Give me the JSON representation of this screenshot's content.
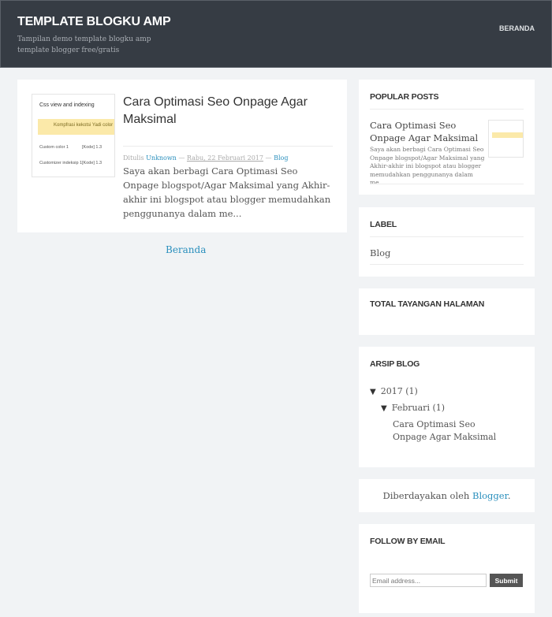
{
  "header": {
    "title": "TEMPLATE BLOGKU AMP",
    "description": "Tampilan demo template blogku amp template blogger free/gratis",
    "nav_home": "BERANDA",
    "background": "#363c44"
  },
  "post": {
    "title": "Cara Optimasi Seo Onpage Agar Maksimal",
    "meta_prefix": "Ditulis",
    "author": "Unknown",
    "sep1": "—",
    "date": "Rabu, 22 Februari 2017",
    "sep2": "—",
    "label": "Blog",
    "excerpt": "Saya akan berbagi Cara Optimasi Seo Onpage blogspot/Agar Maksimal yang Akhir-akhir ini blogspot atau blogger memudahkan penggunanya dalam me...",
    "thumbnail": {
      "heading": "Css view and indexing",
      "band_text": "Kompfrasi kekotsi  Yadi color",
      "row1_label": "Custom color  1",
      "row1_value": "[Kode]  1.3",
      "row2_label": "Customizer  indeksip  1",
      "row2_value": "[Kode]  1.3"
    }
  },
  "pager": {
    "home": "Beranda"
  },
  "sidebar": {
    "popular": {
      "title": "POPULAR POSTS",
      "post_title": "Cara Optimasi Seo Onpage Agar Maksimal",
      "snippet": "Saya akan berbagi Cara Optimasi Seo Onpage blogspot/Agar Maksimal yang Akhir-akhir ini blogspot atau blogger memudahkan penggunanya dalam me..."
    },
    "label": {
      "title": "LABEL",
      "items": [
        "Blog"
      ]
    },
    "pageviews": {
      "title": "TOTAL TAYANGAN HALAMAN"
    },
    "archive": {
      "title": "ARSIP BLOG",
      "year": "2017",
      "year_count": "(1)",
      "month": "Februari",
      "month_count": "(1)",
      "post": "Cara Optimasi Seo Onpage Agar Maksimal",
      "toggle_symbol": "▼"
    },
    "powered": {
      "prefix": "Diberdayakan oleh",
      "link": "Blogger",
      "suffix": "."
    },
    "follow": {
      "title": "FOLLOW BY EMAIL",
      "placeholder": "Email address...",
      "submit": "Submit"
    }
  },
  "colors": {
    "link": "#2a8fbd",
    "page_bg": "#f1f3f5",
    "header_bg": "#363c44"
  }
}
